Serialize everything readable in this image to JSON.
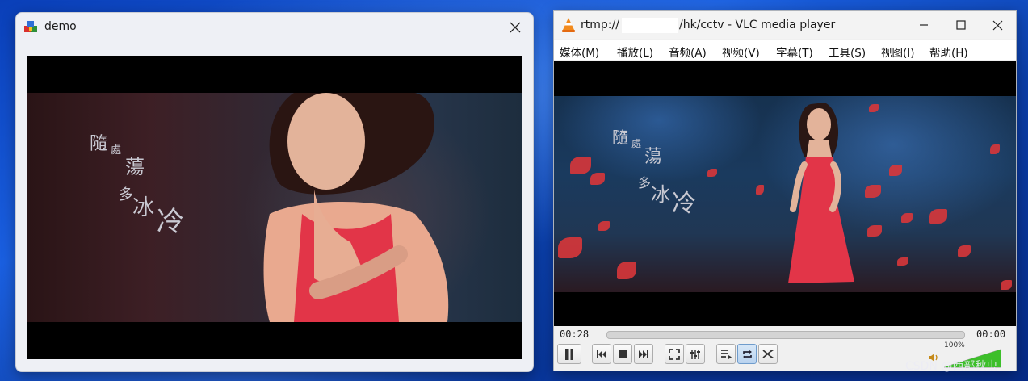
{
  "colors": {
    "accent": "#0b57d0",
    "vlc_orange": "#f28a1c",
    "dress_red": "#e23548",
    "volume_green": "#3dbf2a"
  },
  "demo_window": {
    "title": "demo",
    "icons": {
      "app": "app-cube-icon",
      "close": "close-icon"
    },
    "lyrics": [
      "隨",
      "處",
      "蕩",
      "多",
      "冰",
      "冷"
    ]
  },
  "vlc_window": {
    "title_prefix": "rtmp://",
    "title_suffix": "/hk/cctv - VLC media player",
    "icons": {
      "app": "vlc-cone-icon",
      "minimize": "minimize-icon",
      "maximize": "maximize-icon",
      "close": "close-icon"
    },
    "menu": [
      "媒体(M)",
      "播放(L)",
      "音频(A)",
      "视频(V)",
      "字幕(T)",
      "工具(S)",
      "视图(I)",
      "帮助(H)"
    ],
    "lyrics": [
      "隨",
      "處",
      "蕩",
      "多",
      "冰",
      "冷"
    ],
    "time_elapsed": "00:28",
    "time_total": "00:00",
    "volume": "100%",
    "volume_level": 1.0,
    "controls": [
      "pause-icon",
      "previous-icon",
      "stop-icon",
      "next-icon",
      "fullscreen-icon",
      "extended-settings-icon",
      "playlist-icon",
      "loop-icon",
      "shuffle-icon"
    ],
    "loop_active": true
  },
  "watermark": "CSDN @西部秋虫"
}
